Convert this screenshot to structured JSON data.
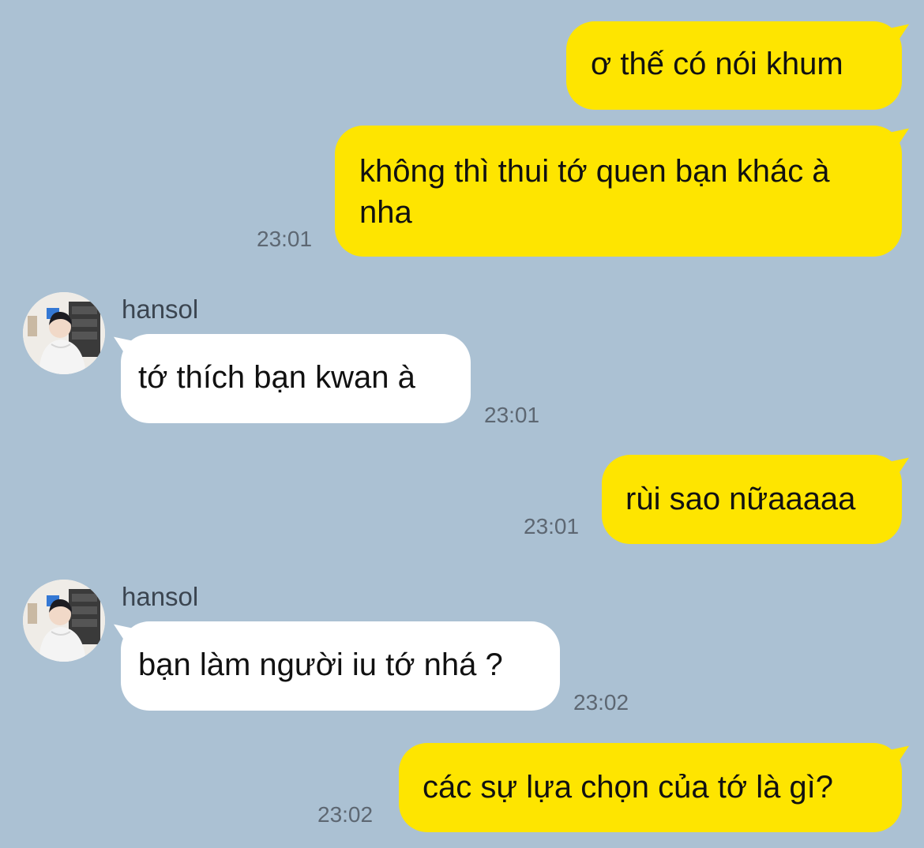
{
  "conversation": {
    "messages": [
      {
        "side": "me",
        "text": "ơ thế có nói khum"
      },
      {
        "side": "me",
        "text": "không thì thui tớ quen bạn khác à nha",
        "time": "23:01"
      },
      {
        "side": "them",
        "sender": "hansol",
        "text": "tớ thích bạn kwan à",
        "time": "23:01"
      },
      {
        "side": "me",
        "text": "rùi sao nữaaaaa",
        "time": "23:01"
      },
      {
        "side": "them",
        "sender": "hansol",
        "text": "bạn làm người iu tớ nhá ?",
        "time": "23:02"
      },
      {
        "side": "me",
        "text": "các sự lựa chọn của tớ là gì?",
        "time": "23:02"
      }
    ]
  },
  "colors": {
    "background": "#abc1d3",
    "my_bubble": "#fee500",
    "their_bubble": "#ffffff",
    "timestamp": "#5d6772"
  }
}
